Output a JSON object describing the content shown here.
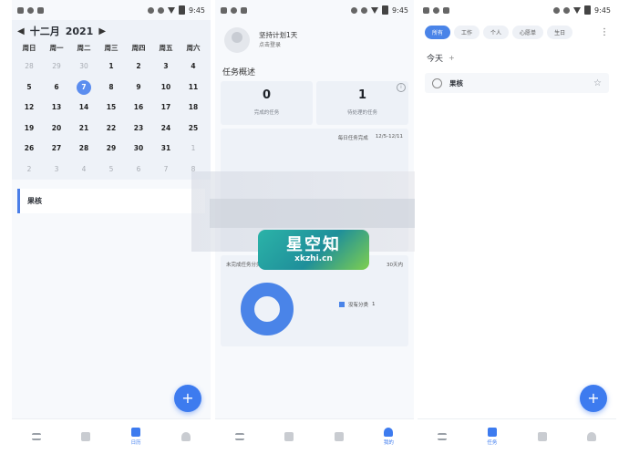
{
  "status": {
    "time": "9:45"
  },
  "calendar": {
    "month_label": "十二月",
    "year": "2021",
    "prev_icon": "chevron-left-icon",
    "next_icon": "chevron-right-icon",
    "weekdays": [
      "周日",
      "周一",
      "周二",
      "周三",
      "周四",
      "周五",
      "周六"
    ],
    "days": [
      {
        "t": "28",
        "m": true
      },
      {
        "t": "29",
        "m": true
      },
      {
        "t": "30",
        "m": true
      },
      {
        "t": "1"
      },
      {
        "t": "2"
      },
      {
        "t": "3"
      },
      {
        "t": "4"
      },
      {
        "t": "5"
      },
      {
        "t": "6"
      },
      {
        "t": "7",
        "sel": true
      },
      {
        "t": "8"
      },
      {
        "t": "9"
      },
      {
        "t": "10"
      },
      {
        "t": "11"
      },
      {
        "t": "12"
      },
      {
        "t": "13"
      },
      {
        "t": "14"
      },
      {
        "t": "15"
      },
      {
        "t": "16"
      },
      {
        "t": "17"
      },
      {
        "t": "18"
      },
      {
        "t": "19"
      },
      {
        "t": "20"
      },
      {
        "t": "21"
      },
      {
        "t": "22"
      },
      {
        "t": "23"
      },
      {
        "t": "24"
      },
      {
        "t": "25"
      },
      {
        "t": "26"
      },
      {
        "t": "27"
      },
      {
        "t": "28"
      },
      {
        "t": "29"
      },
      {
        "t": "30"
      },
      {
        "t": "31"
      },
      {
        "t": "1",
        "m": true
      },
      {
        "t": "2",
        "m": true
      },
      {
        "t": "3",
        "m": true
      },
      {
        "t": "4",
        "m": true
      },
      {
        "t": "5",
        "m": true
      },
      {
        "t": "6",
        "m": true
      },
      {
        "t": "7",
        "m": true
      },
      {
        "t": "8",
        "m": true
      }
    ],
    "task_label": "果核"
  },
  "nav1": {
    "items": [
      "",
      "日历",
      ""
    ],
    "active": 1
  },
  "profile": {
    "line1": "坚持计划1天",
    "line2": "点击登录",
    "overview_title": "任务概述",
    "stat1": {
      "num": "0",
      "label": "完成的任务"
    },
    "stat2": {
      "num": "1",
      "label": "待处理的任务"
    },
    "weekly_title": "每日任务完成",
    "weekly_range": "12/5-12/11",
    "dist_title": "未完成任务分类分布",
    "dist_filter": "30天内",
    "legend_label": "没有分类",
    "legend_value": "1"
  },
  "nav2": {
    "items": [
      "",
      "",
      "",
      "我的"
    ],
    "active": 3
  },
  "tasks": {
    "tabs": [
      "所有",
      "工作",
      "个人",
      "心愿单",
      "生日"
    ],
    "group_title": "今天",
    "item": "果核"
  },
  "nav3": {
    "items": [
      "任务",
      "",
      ""
    ],
    "active": 0
  },
  "fab": {
    "label": "+"
  },
  "watermark": {
    "brand": "星空知",
    "domain": "xkzhi.cn"
  },
  "colors": {
    "accent": "#3d7bef"
  }
}
